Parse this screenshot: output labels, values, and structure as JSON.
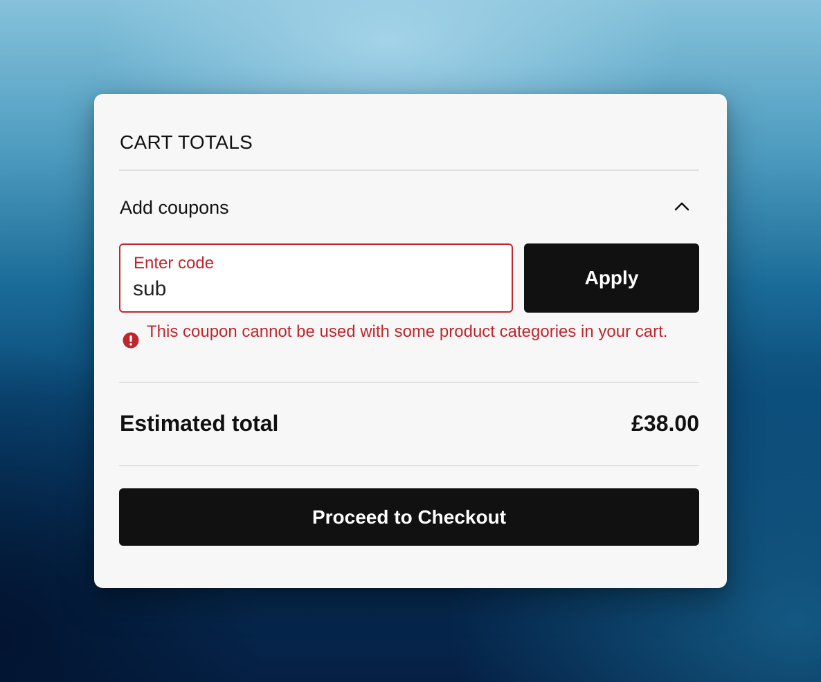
{
  "cart_totals": {
    "title": "CART TOTALS",
    "coupons": {
      "label": "Add coupons",
      "expanded": true,
      "toggle_icon": "chevron-up-icon",
      "input_label": "Enter code",
      "input_value": "sub",
      "apply_label": "Apply",
      "error_icon": "error-circle-icon",
      "error_message": "This coupon cannot be used with some product categories in your cart."
    },
    "estimated_total": {
      "label": "Estimated total",
      "value": "£38.00"
    },
    "checkout_label": "Proceed to Checkout"
  },
  "colors": {
    "error": "#c0262d",
    "button_bg": "#111111",
    "card_bg": "#f7f7f7"
  }
}
